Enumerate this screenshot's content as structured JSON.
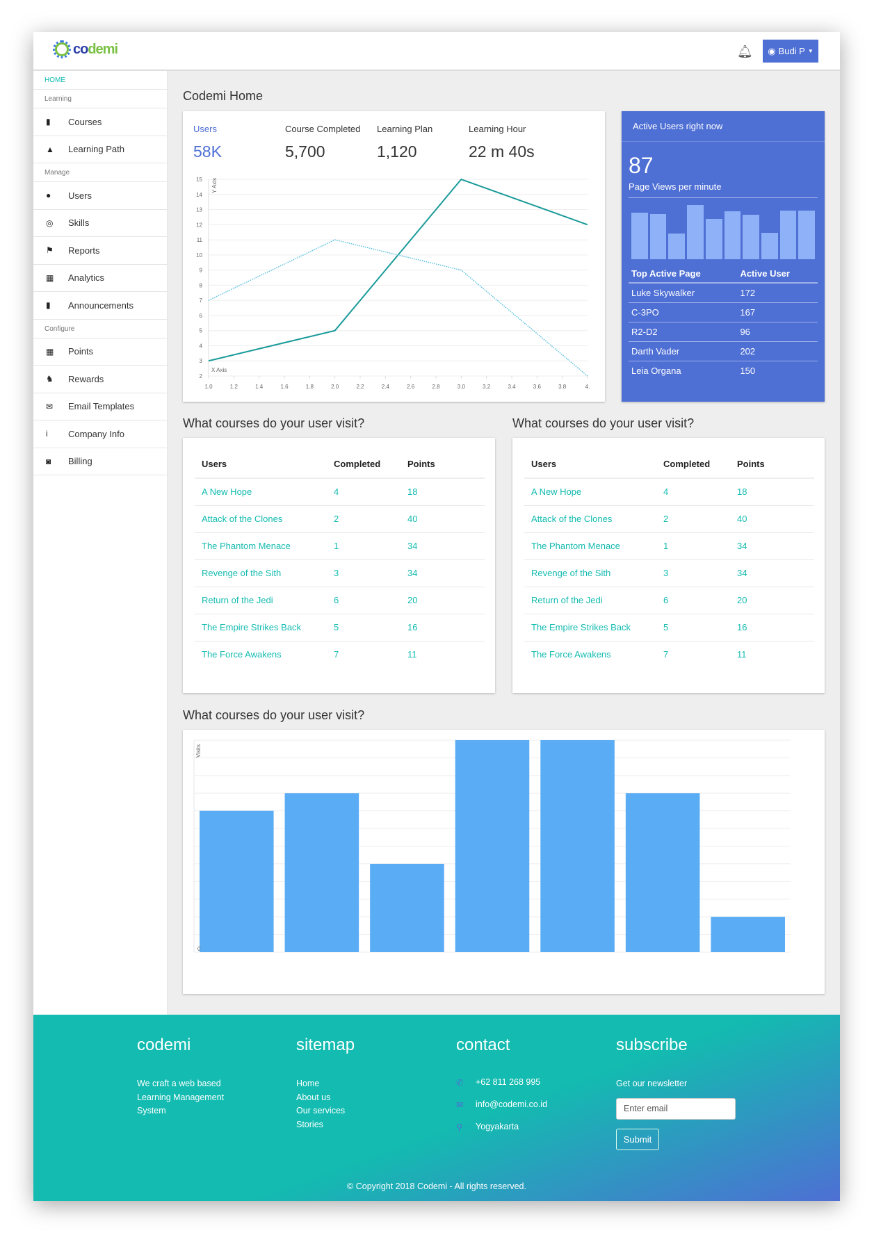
{
  "header": {
    "logo": "codemi",
    "user": "Budi P",
    "icons": {
      "bell": "bell-icon",
      "user": "user-circle-icon"
    }
  },
  "sidebar": [
    {
      "type": "section",
      "label": "HOME"
    },
    {
      "type": "section",
      "label": "Learning"
    },
    {
      "type": "item",
      "label": "Courses",
      "icon": "book-icon",
      "glyph": "▮"
    },
    {
      "type": "item",
      "label": "Learning Path",
      "icon": "road-icon",
      "glyph": "▲"
    },
    {
      "type": "section",
      "label": "Manage"
    },
    {
      "type": "item",
      "label": "Users",
      "icon": "user-icon",
      "glyph": "●"
    },
    {
      "type": "item",
      "label": "Skills",
      "icon": "bicycle-icon",
      "glyph": "◎"
    },
    {
      "type": "item",
      "label": "Reports",
      "icon": "flag-icon",
      "glyph": "⚑"
    },
    {
      "type": "item",
      "label": "Analytics",
      "icon": "calendar-icon",
      "glyph": "▦"
    },
    {
      "type": "item",
      "label": "Announcements",
      "icon": "database-icon",
      "glyph": "▮"
    },
    {
      "type": "section",
      "label": "Configure"
    },
    {
      "type": "item",
      "label": "Points",
      "icon": "calendar-icon",
      "glyph": "▦"
    },
    {
      "type": "item",
      "label": "Rewards",
      "icon": "trophy-icon",
      "glyph": "♞"
    },
    {
      "type": "item",
      "label": "Email Templates",
      "icon": "envelope-icon",
      "glyph": "✉"
    },
    {
      "type": "item",
      "label": "Company Info",
      "icon": "info-icon",
      "glyph": "i"
    },
    {
      "type": "item",
      "label": "Billing",
      "icon": "money-icon",
      "glyph": "◙"
    }
  ],
  "main": {
    "title": "Codemi Home",
    "stats": [
      {
        "label": "Users",
        "value": "58K"
      },
      {
        "label": "Course Completed",
        "value": "5,700"
      },
      {
        "label": "Learning Plan",
        "value": "1,120"
      },
      {
        "label": "Learning Hour",
        "value": "22 m 40s"
      }
    ],
    "active": {
      "title": "Active Users right now",
      "count": "87",
      "sub": "Page Views per minute",
      "bars": [
        174,
        169,
        98,
        204,
        152,
        180,
        167,
        99,
        184,
        184
      ],
      "headers": [
        "Top Active Page",
        "Active User"
      ],
      "rows": [
        [
          "Luke Skywalker",
          "172"
        ],
        [
          "C-3PO",
          "167"
        ],
        [
          "R2-D2",
          "96"
        ],
        [
          "Darth Vader",
          "202"
        ],
        [
          "Leia Organa",
          "150"
        ]
      ]
    },
    "table_title": "What courses do your user visit?",
    "table": {
      "headers": [
        "Users",
        "Completed",
        "Points"
      ],
      "rows": [
        [
          "A New Hope",
          "4",
          "18"
        ],
        [
          "Attack of the Clones",
          "2",
          "40"
        ],
        [
          "The Phantom Menace",
          "1",
          "34"
        ],
        [
          "Revenge of the Sith",
          "3",
          "34"
        ],
        [
          "Return of the Jedi",
          "6",
          "20"
        ],
        [
          "The Empire Strikes Back",
          "5",
          "16"
        ],
        [
          "The Force Awakens",
          "7",
          "11"
        ]
      ]
    },
    "bar_title": "What courses do your user visit?"
  },
  "chart_data": [
    {
      "type": "line",
      "xlabel": "X Axis",
      "ylabel": "Y Axis",
      "xlim": [
        1.0,
        4.0
      ],
      "ylim": [
        2,
        15
      ],
      "grid": true,
      "xticks": [
        "1.0",
        "1.2",
        "1.4",
        "1.6",
        "1.8",
        "2.0",
        "2.2",
        "2.4",
        "2.6",
        "2.8",
        "3.0",
        "3.2",
        "3.4",
        "3.6",
        "3.8",
        "4."
      ],
      "yticks": [
        "2",
        "3",
        "4",
        "5",
        "6",
        "7",
        "8",
        "9",
        "10",
        "11",
        "12",
        "13",
        "14",
        "15"
      ],
      "series": [
        {
          "style": "solid",
          "color": "#1a9a9a",
          "x": [
            1,
            2,
            3,
            4
          ],
          "y": [
            3,
            5,
            15,
            12
          ]
        },
        {
          "style": "dotted",
          "color": "#5bc0de",
          "x": [
            1,
            2,
            3,
            4
          ],
          "y": [
            7,
            11,
            9,
            2
          ]
        }
      ]
    },
    {
      "type": "bar",
      "ylabel": "Visits",
      "ylim": [
        0,
        12
      ],
      "grid": true,
      "yticks": [
        "0"
      ],
      "color": "#5aacf5",
      "values": [
        8,
        9,
        5,
        12,
        12,
        9,
        2
      ]
    }
  ],
  "footer": {
    "brand": {
      "title": "codemi",
      "text": "We craft a web based Learning Management System"
    },
    "sitemap": {
      "title": "sitemap",
      "links": [
        "Home",
        "About us",
        "Our services",
        "Stories"
      ]
    },
    "contact": {
      "title": "contact",
      "phone": "+62 811 268 995",
      "email": "info@codemi.co.id",
      "city": "Yogyakarta"
    },
    "subscribe": {
      "title": "subscribe",
      "label": "Get our newsletter",
      "placeholder": "Enter email",
      "button": "Submit"
    },
    "copyright": "© Copyright 2018 Codemi - All rights reserved."
  }
}
